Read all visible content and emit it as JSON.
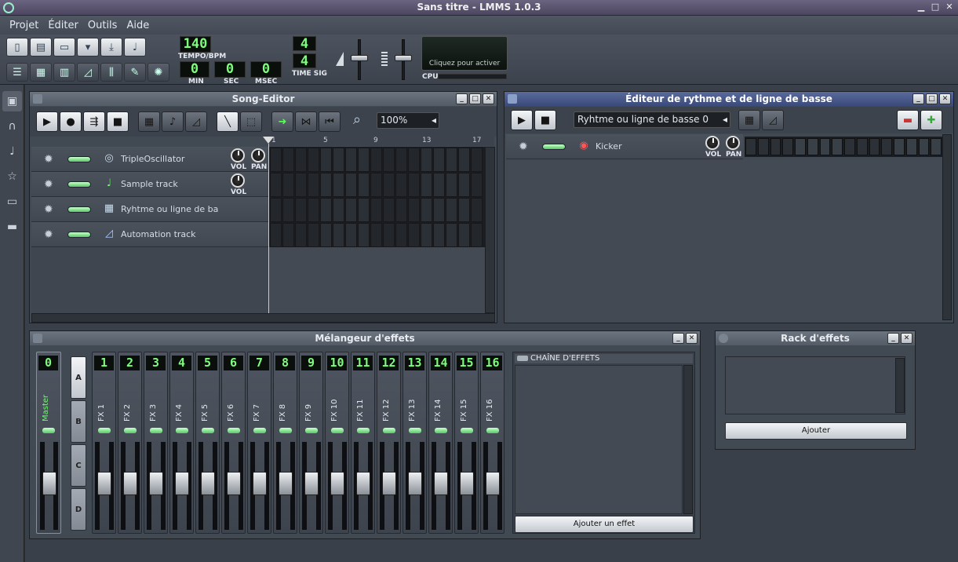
{
  "window": {
    "title": "Sans titre - LMMS 1.0.3"
  },
  "menu": [
    "Projet",
    "Éditer",
    "Outils",
    "Aide"
  ],
  "toolbar": {
    "tempo": "140",
    "tempo_label": "TEMPO/BPM",
    "min": "0",
    "sec": "0",
    "msec": "0",
    "min_label": "MIN",
    "sec_label": "SEC",
    "msec_label": "MSEC",
    "timesig_top": "4",
    "timesig_bottom": "4",
    "timesig_label": "TIME SIG",
    "cpu_message": "Cliquez pour activer",
    "cpu_label": "CPU"
  },
  "song_editor": {
    "title": "Song-Editor",
    "zoom": "100%",
    "ruler": [
      "1",
      "5",
      "9",
      "13",
      "17"
    ],
    "tracks": [
      {
        "name": "TripleOscillator",
        "icon": "oscillator-icon",
        "knobs": [
          "VOL",
          "PAN"
        ]
      },
      {
        "name": "Sample track",
        "icon": "note-icon",
        "knobs": [
          "VOL"
        ]
      },
      {
        "name": "Ryhtme ou ligne de ba",
        "icon": "beat-grid-icon",
        "knobs": []
      },
      {
        "name": "Automation track",
        "icon": "automation-icon",
        "knobs": []
      }
    ]
  },
  "beat_editor": {
    "title": "Éditeur de rythme et de ligne de basse",
    "selector": "Ryhtme ou ligne de basse 0",
    "track_name": "Kicker",
    "knobs": [
      "VOL",
      "PAN"
    ],
    "steps": 16
  },
  "mixer": {
    "title": "Mélangeur d'effets",
    "master_num": "0",
    "master_name": "Master",
    "banks": [
      "A",
      "B",
      "C",
      "D"
    ],
    "channels": [
      {
        "num": "1",
        "name": "FX 1"
      },
      {
        "num": "2",
        "name": "FX 2"
      },
      {
        "num": "3",
        "name": "FX 3"
      },
      {
        "num": "4",
        "name": "FX 4"
      },
      {
        "num": "5",
        "name": "FX 5"
      },
      {
        "num": "6",
        "name": "FX 6"
      },
      {
        "num": "7",
        "name": "FX 7"
      },
      {
        "num": "8",
        "name": "FX 8"
      },
      {
        "num": "9",
        "name": "FX 9"
      },
      {
        "num": "10",
        "name": "FX 10"
      },
      {
        "num": "11",
        "name": "FX 11"
      },
      {
        "num": "12",
        "name": "FX 12"
      },
      {
        "num": "13",
        "name": "FX 13"
      },
      {
        "num": "14",
        "name": "FX 14"
      },
      {
        "num": "15",
        "name": "FX 15"
      },
      {
        "num": "16",
        "name": "FX 16"
      }
    ],
    "chain_label": "CHAÎNE D'EFFETS",
    "add_effect": "Ajouter un effet"
  },
  "rack": {
    "title": "Rack d'effets",
    "add": "Ajouter"
  }
}
